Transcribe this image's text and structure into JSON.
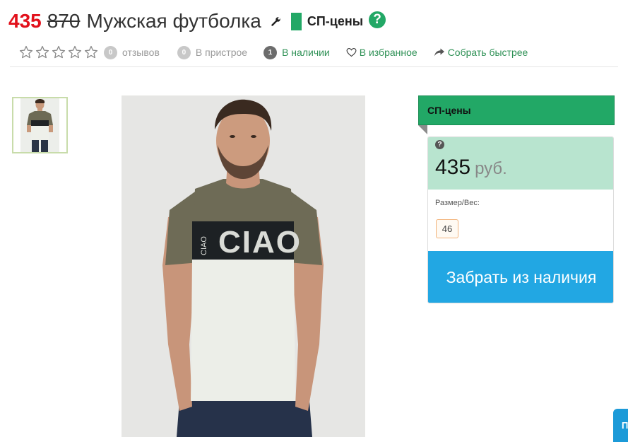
{
  "product": {
    "price_new": "435",
    "price_old": "870",
    "title": "Мужская футболка",
    "sp_label": "СП-цены",
    "help_symbol": "?"
  },
  "meta": {
    "rating_stars": 0,
    "reviews": {
      "count": "0",
      "label": "отзывов"
    },
    "attached": {
      "count": "0",
      "label": "В пристрое"
    },
    "stock": {
      "count": "1",
      "label": "В наличии"
    },
    "favorite_label": "В избранное",
    "collect_label": "Собрать быстрее"
  },
  "panel": {
    "header": "СП-цены",
    "help_symbol": "?",
    "price": "435",
    "currency": "руб.",
    "size_label": "Размер/Вес:",
    "size_value": "46",
    "button_label": "Забрать из наличия"
  },
  "chat_button_label": "П",
  "icons": {
    "edit": "wrench-icon",
    "help": "question-circle-icon",
    "favorite": "heart-icon",
    "share": "share-arrow-icon",
    "star": "star-outline-icon"
  },
  "colors": {
    "price_red": "#e2111b",
    "brand_green": "#22a866",
    "link_green": "#2f9156",
    "price_area": "#b8e4cf",
    "button_blue": "#22a7e3"
  }
}
